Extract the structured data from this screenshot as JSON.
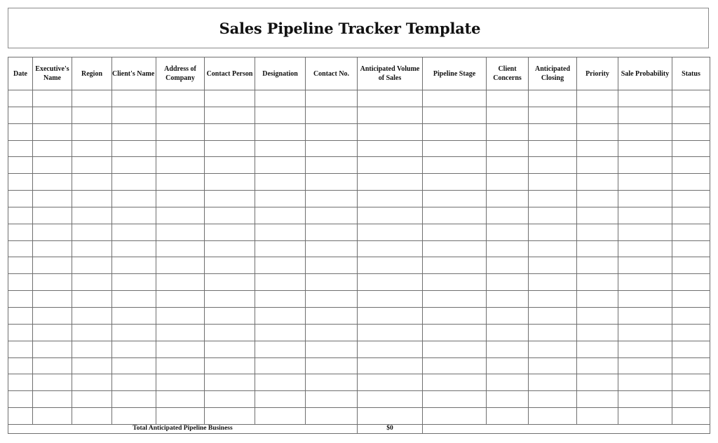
{
  "title": "Sales Pipeline Tracker Template",
  "table": {
    "columns": [
      {
        "key": "date",
        "label": "Date"
      },
      {
        "key": "executive_name",
        "label": "Executive's Name"
      },
      {
        "key": "region",
        "label": "Region"
      },
      {
        "key": "client_name",
        "label": "Client's Name"
      },
      {
        "key": "address_of_company",
        "label": "Address of Company"
      },
      {
        "key": "contact_person",
        "label": "Contact Person"
      },
      {
        "key": "designation",
        "label": "Designation"
      },
      {
        "key": "contact_no",
        "label": "Contact No."
      },
      {
        "key": "anticipated_volume",
        "label": "Anticipated Volume of Sales"
      },
      {
        "key": "pipeline_stage",
        "label": "Pipeline Stage"
      },
      {
        "key": "client_concerns",
        "label": "Client Concerns"
      },
      {
        "key": "anticipated_closing",
        "label": "Anticipated Closing"
      },
      {
        "key": "priority",
        "label": "Priority"
      },
      {
        "key": "sale_probability",
        "label": "Sale Probability"
      },
      {
        "key": "status",
        "label": "Status"
      }
    ],
    "rows": [
      [
        "",
        "",
        "",
        "",
        "",
        "",
        "",
        "",
        "",
        "",
        "",
        "",
        "",
        "",
        ""
      ],
      [
        "",
        "",
        "",
        "",
        "",
        "",
        "",
        "",
        "",
        "",
        "",
        "",
        "",
        "",
        ""
      ],
      [
        "",
        "",
        "",
        "",
        "",
        "",
        "",
        "",
        "",
        "",
        "",
        "",
        "",
        "",
        ""
      ],
      [
        "",
        "",
        "",
        "",
        "",
        "",
        "",
        "",
        "",
        "",
        "",
        "",
        "",
        "",
        ""
      ],
      [
        "",
        "",
        "",
        "",
        "",
        "",
        "",
        "",
        "",
        "",
        "",
        "",
        "",
        "",
        ""
      ],
      [
        "",
        "",
        "",
        "",
        "",
        "",
        "",
        "",
        "",
        "",
        "",
        "",
        "",
        "",
        ""
      ],
      [
        "",
        "",
        "",
        "",
        "",
        "",
        "",
        "",
        "",
        "",
        "",
        "",
        "",
        "",
        ""
      ],
      [
        "",
        "",
        "",
        "",
        "",
        "",
        "",
        "",
        "",
        "",
        "",
        "",
        "",
        "",
        ""
      ],
      [
        "",
        "",
        "",
        "",
        "",
        "",
        "",
        "",
        "",
        "",
        "",
        "",
        "",
        "",
        ""
      ],
      [
        "",
        "",
        "",
        "",
        "",
        "",
        "",
        "",
        "",
        "",
        "",
        "",
        "",
        "",
        ""
      ],
      [
        "",
        "",
        "",
        "",
        "",
        "",
        "",
        "",
        "",
        "",
        "",
        "",
        "",
        "",
        ""
      ],
      [
        "",
        "",
        "",
        "",
        "",
        "",
        "",
        "",
        "",
        "",
        "",
        "",
        "",
        "",
        ""
      ],
      [
        "",
        "",
        "",
        "",
        "",
        "",
        "",
        "",
        "",
        "",
        "",
        "",
        "",
        "",
        ""
      ],
      [
        "",
        "",
        "",
        "",
        "",
        "",
        "",
        "",
        "",
        "",
        "",
        "",
        "",
        "",
        ""
      ],
      [
        "",
        "",
        "",
        "",
        "",
        "",
        "",
        "",
        "",
        "",
        "",
        "",
        "",
        "",
        ""
      ],
      [
        "",
        "",
        "",
        "",
        "",
        "",
        "",
        "",
        "",
        "",
        "",
        "",
        "",
        "",
        ""
      ],
      [
        "",
        "",
        "",
        "",
        "",
        "",
        "",
        "",
        "",
        "",
        "",
        "",
        "",
        "",
        ""
      ],
      [
        "",
        "",
        "",
        "",
        "",
        "",
        "",
        "",
        "",
        "",
        "",
        "",
        "",
        "",
        ""
      ],
      [
        "",
        "",
        "",
        "",
        "",
        "",
        "",
        "",
        "",
        "",
        "",
        "",
        "",
        "",
        ""
      ],
      [
        "",
        "",
        "",
        "",
        "",
        "",
        "",
        "",
        "",
        "",
        "",
        "",
        "",
        "",
        ""
      ]
    ],
    "total": {
      "label": "Total Anticipated Pipeline Business",
      "value": "$0"
    }
  }
}
